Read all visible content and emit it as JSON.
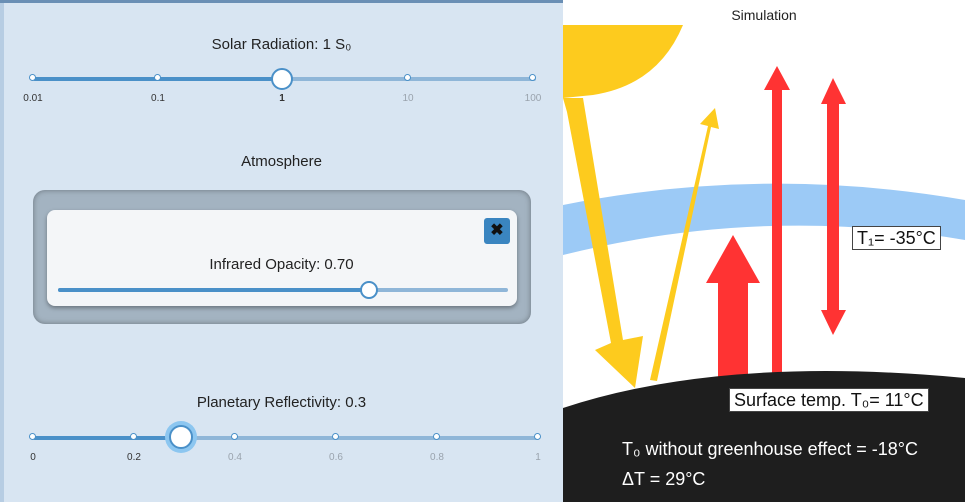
{
  "controls": {
    "solar": {
      "label": "Solar Radiation: 1 S₀",
      "ticks": [
        "0.01",
        "0.1",
        "1",
        "10",
        "100"
      ],
      "value_tick_index": 2
    },
    "atmosphere": {
      "heading": "Atmosphere",
      "close_symbol": "✖",
      "opacity_label": "Infrared Opacity: 0.70",
      "opacity_value": 0.7
    },
    "reflectivity": {
      "label": "Planetary Reflectivity: 0.3",
      "ticks": [
        "0",
        "0.2",
        "0.4",
        "0.6",
        "0.8",
        "1"
      ],
      "value": 0.3
    }
  },
  "simulation": {
    "title": "Simulation",
    "t1_label": "T₁= -35°C",
    "surface_label": "Surface temp. T₀= 11°C",
    "no_greenhouse_text": "T₀ without greenhouse effect = -18°C",
    "delta_text": "ΔT = 29°C"
  },
  "colors": {
    "panel": "#d8e5f2",
    "slider_accent": "#4a90c8",
    "sun": "#fdcb1e",
    "atmosphere_band": "#9ccaf6",
    "ir_arrow": "#ff3333",
    "ground": "#1e1e1e"
  }
}
